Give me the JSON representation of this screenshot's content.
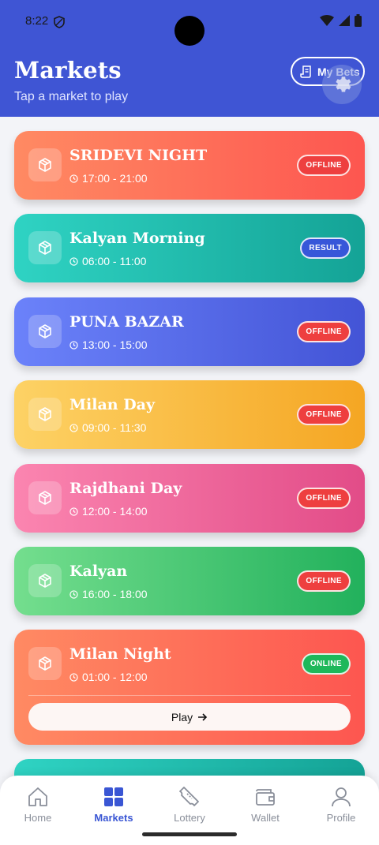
{
  "status": {
    "time": "8:22"
  },
  "header": {
    "title": "Markets",
    "subtitle": "Tap a market to play",
    "mybets_label": "My Bets"
  },
  "markets": [
    {
      "name": "SRIDEVI NIGHT",
      "time": "17:00 - 21:00",
      "status": "OFFLINE"
    },
    {
      "name": "Kalyan Morning",
      "time": "06:00 - 11:00",
      "status": "RESULT"
    },
    {
      "name": "PUNA BAZAR",
      "time": "13:00 - 15:00",
      "status": "OFFLINE"
    },
    {
      "name": "Milan Day",
      "time": "09:00 - 11:30",
      "status": "OFFLINE"
    },
    {
      "name": "Rajdhani Day",
      "time": "12:00 - 14:00",
      "status": "OFFLINE"
    },
    {
      "name": "Kalyan",
      "time": "16:00 - 18:00",
      "status": "OFFLINE"
    },
    {
      "name": "Milan Night",
      "time": "01:00 - 12:00",
      "status": "ONLINE",
      "play_label": "Play"
    }
  ],
  "nav": [
    {
      "label": "Home",
      "icon": "home-icon"
    },
    {
      "label": "Markets",
      "icon": "grid-icon"
    },
    {
      "label": "Lottery",
      "icon": "ticket-icon"
    },
    {
      "label": "Wallet",
      "icon": "wallet-icon"
    },
    {
      "label": "Profile",
      "icon": "profile-icon"
    }
  ],
  "colors": {
    "header": "#3f55d4",
    "accent": "#3a56d4",
    "offline": "#ee3f3f",
    "online": "#1eb85a"
  }
}
